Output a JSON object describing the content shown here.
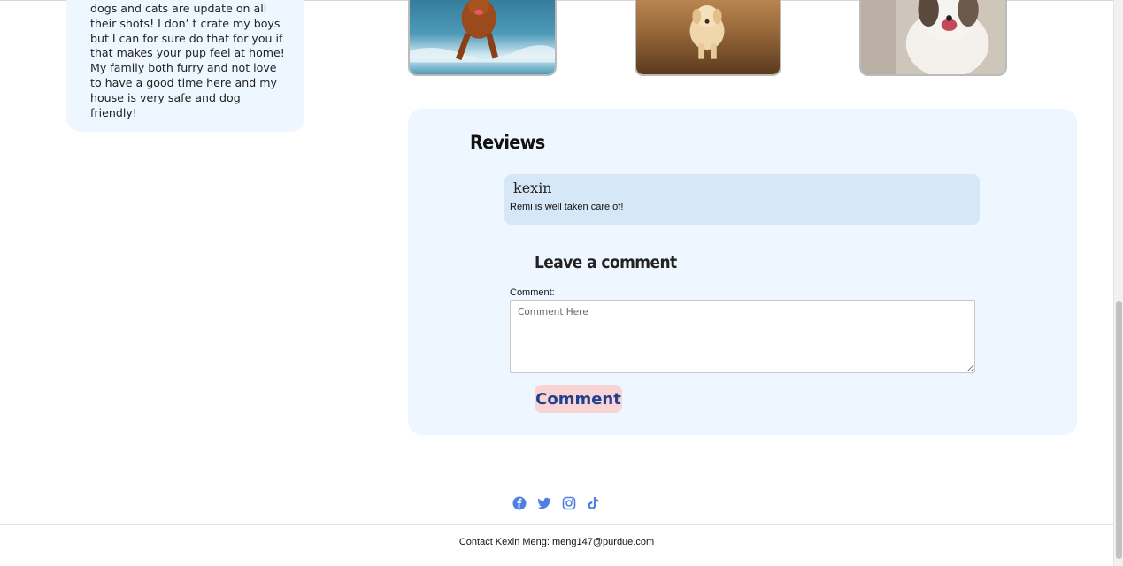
{
  "bio": {
    "text": "dogs and cats are update on all their shots! I don’ t crate my boys but I can for sure do that for you if that makes your pup feel at home! My family both furry and not love to have a good time here and my house is very safe and dog friendly!"
  },
  "gallery": {
    "photos": [
      "dog-on-beach-photo",
      "golden-retriever-puppy-photo",
      "australian-shepherd-photo"
    ]
  },
  "reviews": {
    "title": "Reviews",
    "items": [
      {
        "author": "kexin",
        "text": "Remi is well taken care of!"
      }
    ]
  },
  "comment_form": {
    "title": "Leave a comment",
    "label": "Comment:",
    "placeholder": "Comment Here",
    "button_label": "Comment",
    "button_color": "#f9d4d4",
    "button_text_color": "#23408e"
  },
  "social": {
    "icons": [
      "facebook-icon",
      "twitter-icon",
      "instagram-icon",
      "tiktok-icon"
    ],
    "color": "#4f80e1"
  },
  "footer": {
    "contact": "Contact Kexin Meng: meng147@purdue.com"
  },
  "colors": {
    "panel_background": "#eef6ff",
    "review_card": "#d6e7f8"
  }
}
